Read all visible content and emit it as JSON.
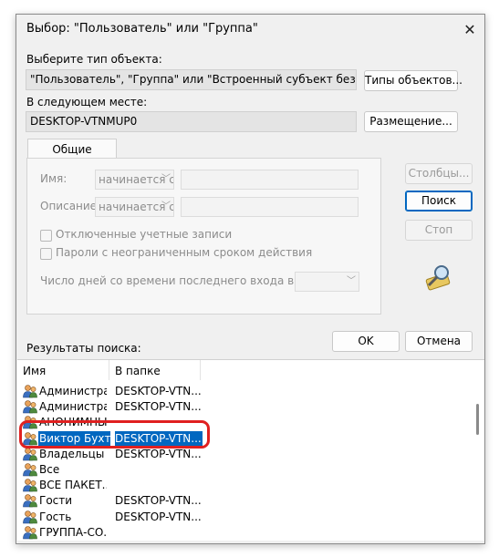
{
  "window": {
    "title": "Выбор: \"Пользователь\" или \"Группа\"",
    "close_glyph": "✕"
  },
  "object_type": {
    "label": "Выберите тип объекта:",
    "value": "\"Пользователь\", \"Группа\" или \"Встроенный субъект безопасности\"",
    "button": "Типы объектов..."
  },
  "location": {
    "label": "В следующем месте:",
    "value": "DESKTOP-VTNMUP0",
    "button": "Размещение..."
  },
  "tabs": {
    "common_queries": "Общие запросы"
  },
  "query": {
    "name_label": "Имя:",
    "name_combo": "начинается с",
    "description_label": "Описание:",
    "description_combo": "начинается с",
    "disabled_accounts": "Отключенные учетные записи",
    "non_expiring_pw": "Пароли с неограниченным сроком действия",
    "days_since_login": "Число дней со времени последнего входа в систему:"
  },
  "side_buttons": {
    "columns": "Столбцы...",
    "search": "Поиск",
    "stop": "Стоп"
  },
  "ok": "OK",
  "cancel": "Отмена",
  "results": {
    "label": "Результаты поиска:",
    "columns": {
      "name": "Имя",
      "folder": "В папке"
    },
    "rows": [
      {
        "name": "Администрат...",
        "folder": "DESKTOP-VTN..."
      },
      {
        "name": "Администрат...",
        "folder": "DESKTOP-VTN..."
      },
      {
        "name": "АНОНИМНЫ...",
        "folder": ""
      },
      {
        "name": "Виктор Бухте...",
        "folder": "DESKTOP-VTN...",
        "selected": true
      },
      {
        "name": "Владельцы у...",
        "folder": "DESKTOP-VTN..."
      },
      {
        "name": "Все",
        "folder": ""
      },
      {
        "name": "ВСЕ ПАКЕТ...",
        "folder": ""
      },
      {
        "name": "Гости",
        "folder": "DESKTOP-VTN..."
      },
      {
        "name": "Гость",
        "folder": "DESKTOP-VTN..."
      },
      {
        "name": "ГРУППА-СО...",
        "folder": ""
      }
    ]
  },
  "colors": {
    "selection": "#0067c0",
    "highlight_ring": "#e02020",
    "dialog_bg": "#f0f0f0"
  }
}
